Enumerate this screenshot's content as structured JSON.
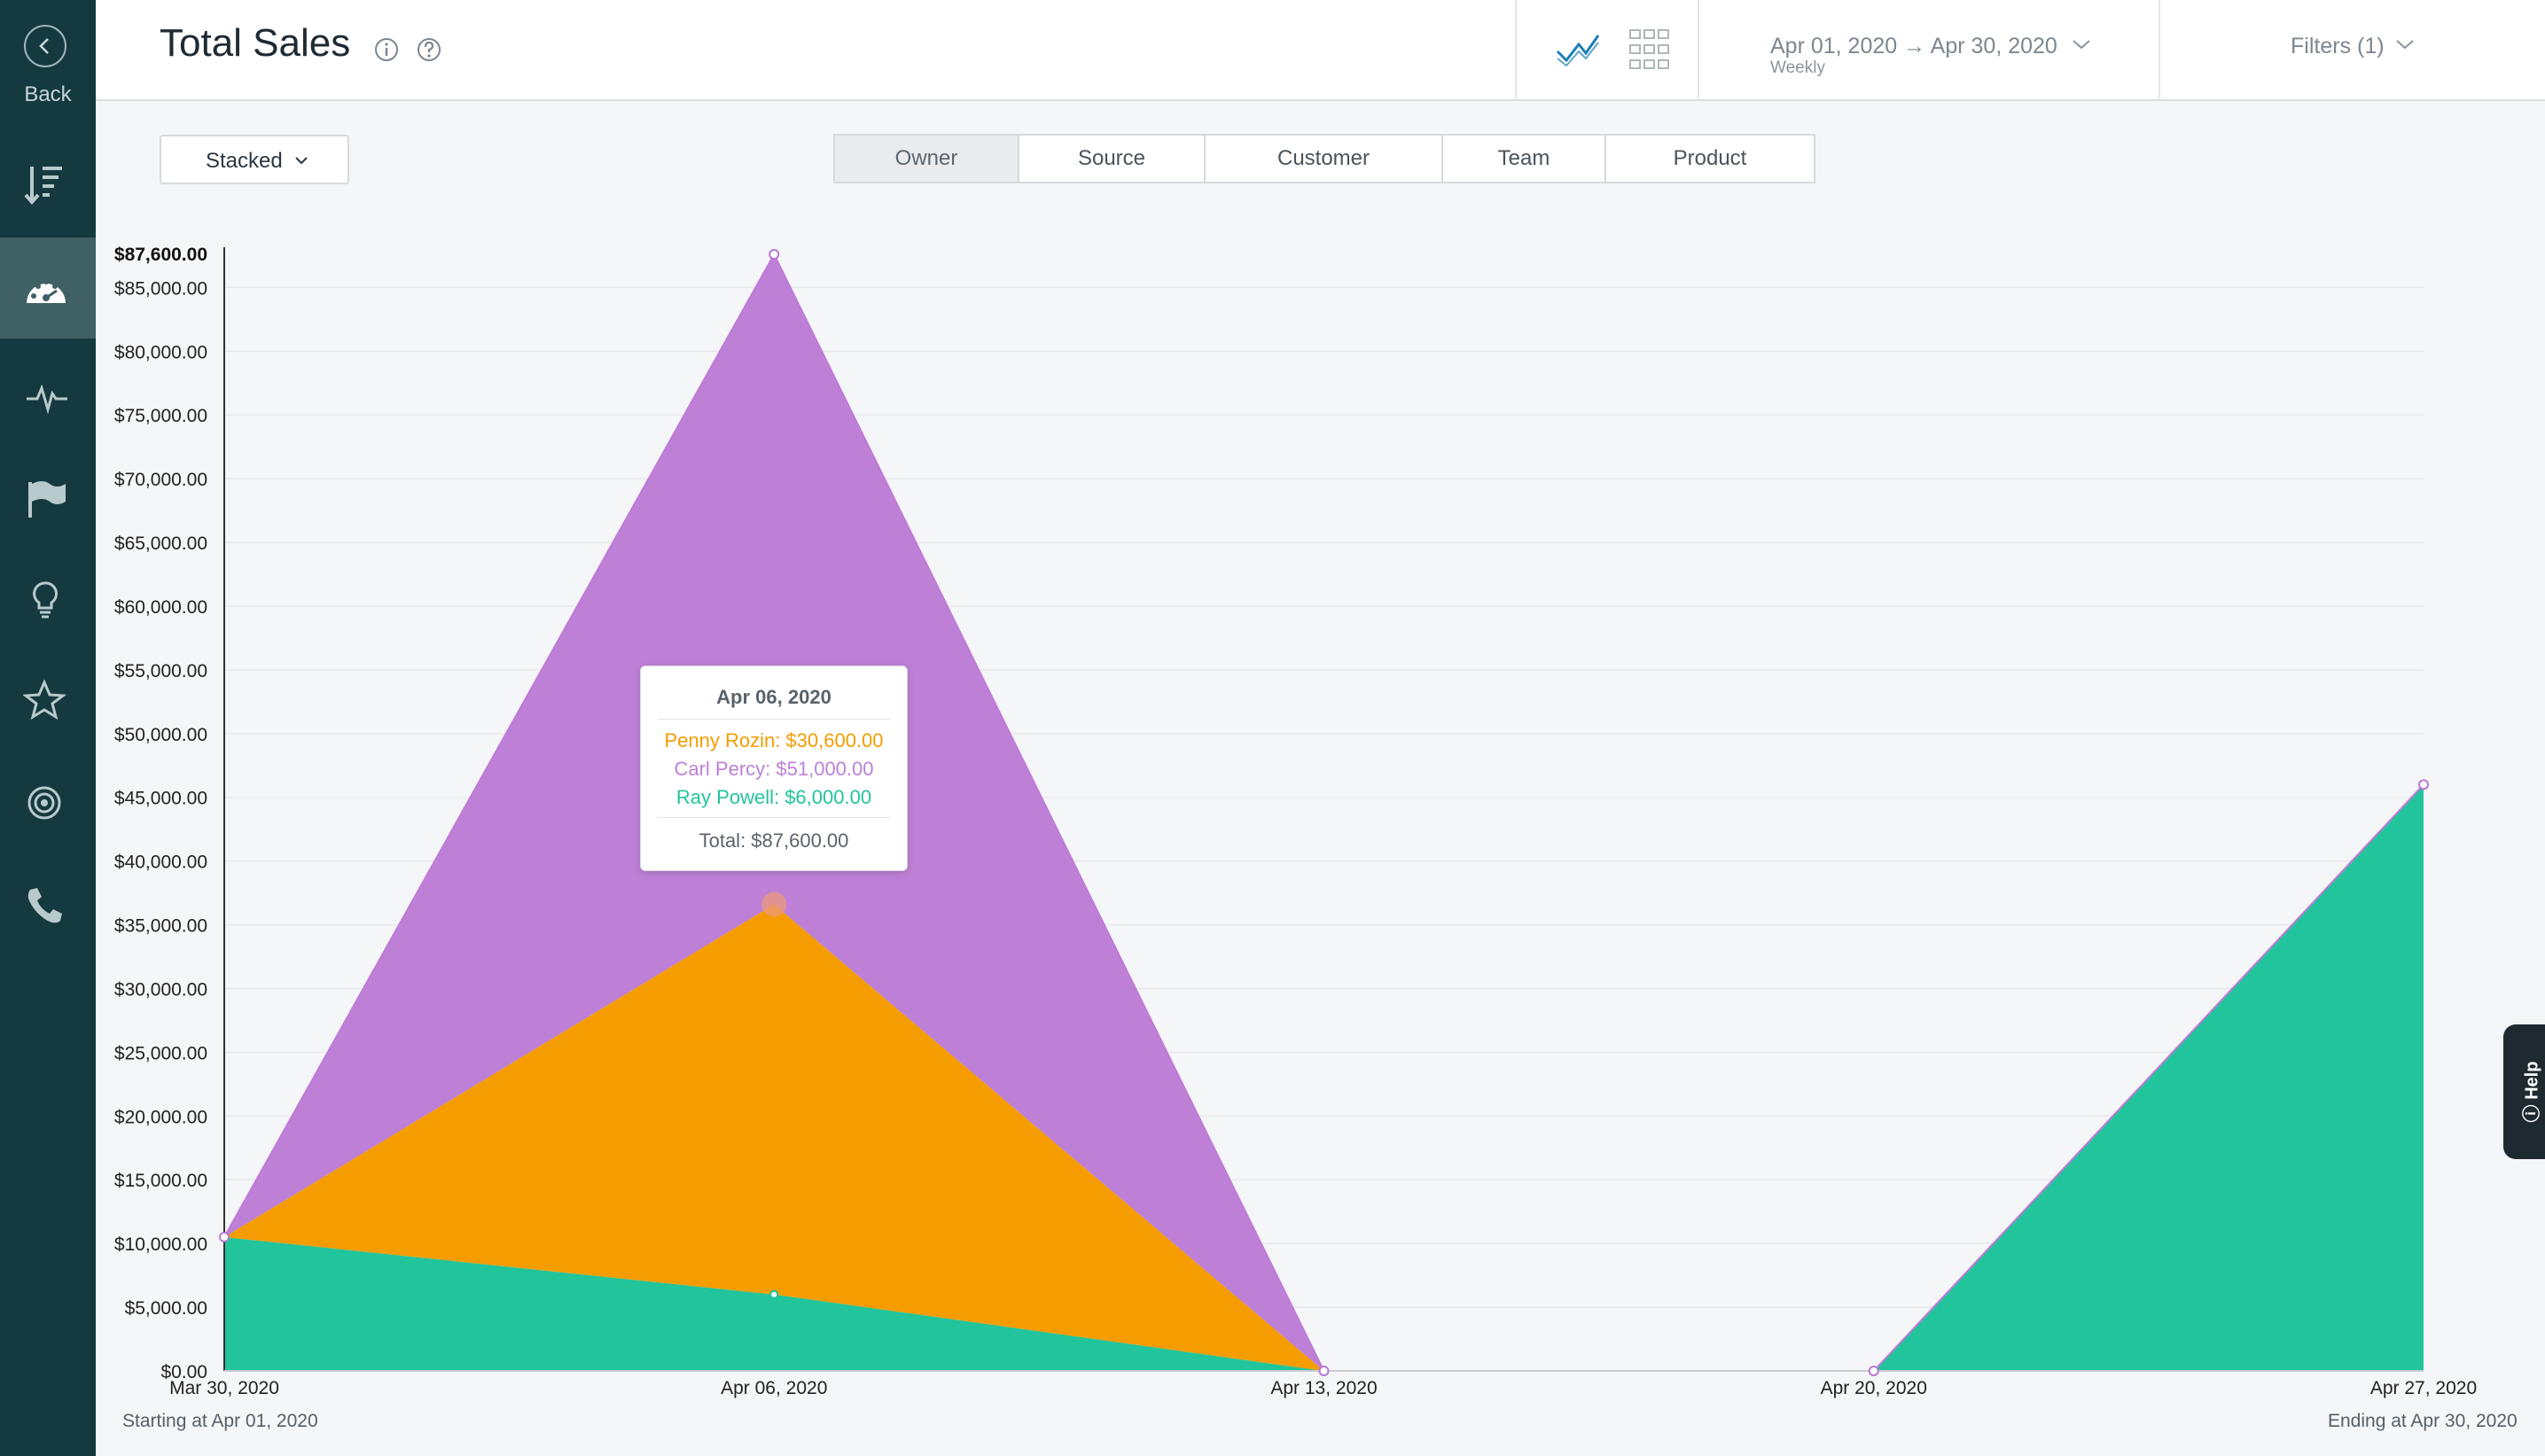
{
  "sidebar": {
    "back_label": "Back",
    "items": [
      {
        "icon": "sort-icon"
      },
      {
        "icon": "dashboard-gauge-icon",
        "active": true
      },
      {
        "icon": "activity-pulse-icon"
      },
      {
        "icon": "flag-icon"
      },
      {
        "icon": "lightbulb-icon"
      },
      {
        "icon": "star-icon"
      },
      {
        "icon": "target-icon"
      },
      {
        "icon": "phone-icon"
      }
    ]
  },
  "header": {
    "title": "Total Sales",
    "date_range": "Apr 01, 2020 → Apr 30, 2020",
    "date_interval": "Weekly",
    "filters_label": "Filters (1)"
  },
  "controls": {
    "stacked_label": "Stacked",
    "tabs": [
      {
        "label": "Owner",
        "active": true
      },
      {
        "label": "Source"
      },
      {
        "label": "Customer"
      },
      {
        "label": "Team"
      },
      {
        "label": "Product"
      }
    ]
  },
  "chart_data": {
    "type": "area",
    "stacked": true,
    "x": [
      "Mar 30, 2020",
      "Apr 06, 2020",
      "Apr 13, 2020",
      "Apr 20, 2020",
      "Apr 27, 2020"
    ],
    "ylim": [
      0,
      87600
    ],
    "y_ticks": [
      "$0.00",
      "$5,000.00",
      "$10,000.00",
      "$15,000.00",
      "$20,000.00",
      "$25,000.00",
      "$30,000.00",
      "$35,000.00",
      "$40,000.00",
      "$45,000.00",
      "$50,000.00",
      "$55,000.00",
      "$60,000.00",
      "$65,000.00",
      "$70,000.00",
      "$75,000.00",
      "$80,000.00",
      "$85,000.00"
    ],
    "y_tick_values": [
      0,
      5000,
      10000,
      15000,
      20000,
      25000,
      30000,
      35000,
      40000,
      45000,
      50000,
      55000,
      60000,
      65000,
      70000,
      75000,
      80000,
      85000
    ],
    "y_max_label": "$87,600.00",
    "grid": true,
    "series": [
      {
        "name": "Ray Powell",
        "color": "#22c49c",
        "values": [
          10500,
          6000,
          0,
          0,
          46000
        ]
      },
      {
        "name": "Penny Rozin",
        "color": "#f59c00",
        "values": [
          0,
          30600,
          0,
          0,
          0
        ]
      },
      {
        "name": "Carl Percy",
        "color": "#bd80d6",
        "values": [
          0,
          51000,
          0,
          0,
          0
        ]
      }
    ],
    "start_note": "Starting at Apr 01, 2020",
    "end_note": "Ending at Apr 30, 2020"
  },
  "tooltip": {
    "date": "Apr 06, 2020",
    "lines": [
      {
        "text": "Penny Rozin: $30,600.00",
        "color": "#f59c00"
      },
      {
        "text": "Carl Percy: $51,000.00",
        "color": "#bd80d6"
      },
      {
        "text": "Ray Powell: $6,000.00",
        "color": "#22c49c"
      }
    ],
    "total": "Total: $87,600.00"
  },
  "help_label": "Help"
}
